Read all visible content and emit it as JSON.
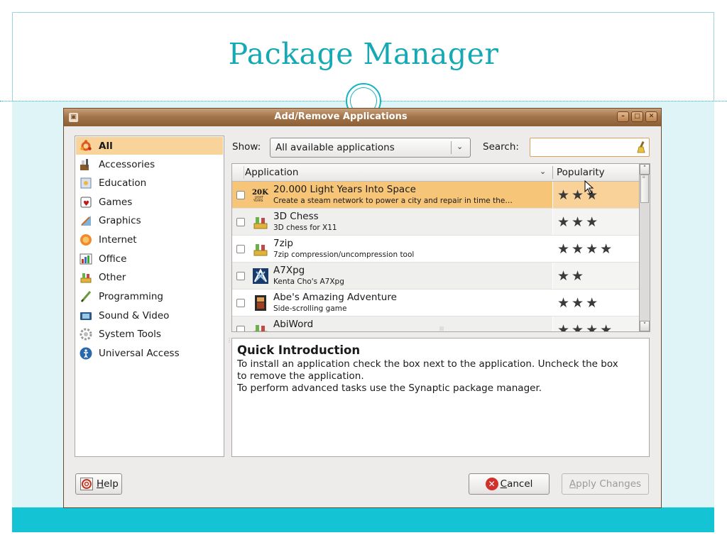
{
  "slide": {
    "title": "Package Manager",
    "colors": {
      "accent": "#14b3c0",
      "title": "#14a9b4",
      "footer": "#14c3d4",
      "body_bg": "#dff4f6"
    }
  },
  "window": {
    "title": "Add/Remove Applications",
    "icon": "package-icon",
    "controls": [
      "minimize-icon",
      "maximize-icon",
      "close-icon"
    ]
  },
  "categories": [
    {
      "label": "All",
      "icon": "ubuntu-logo-icon",
      "selected": true
    },
    {
      "label": "Accessories",
      "icon": "accessories-icon"
    },
    {
      "label": "Education",
      "icon": "education-icon"
    },
    {
      "label": "Games",
      "icon": "games-icon"
    },
    {
      "label": "Graphics",
      "icon": "graphics-icon"
    },
    {
      "label": "Internet",
      "icon": "internet-icon"
    },
    {
      "label": "Office",
      "icon": "office-icon"
    },
    {
      "label": "Other",
      "icon": "other-icon"
    },
    {
      "label": "Programming",
      "icon": "programming-icon"
    },
    {
      "label": "Sound & Video",
      "icon": "sound-video-icon"
    },
    {
      "label": "System Tools",
      "icon": "system-tools-icon"
    },
    {
      "label": "Universal Access",
      "icon": "universal-access-icon"
    }
  ],
  "filter": {
    "show_label": "Show:",
    "show_value": "All available applications",
    "search_label": "Search:",
    "search_value": ""
  },
  "app_list": {
    "columns": {
      "application": "Application",
      "popularity": "Popularity"
    },
    "rows": [
      {
        "name": "20.000 Light Years Into Space",
        "description": "Create a steam network to power a city and repair in time the…",
        "icon_text": "20K",
        "rating": 3,
        "selected": true
      },
      {
        "name": "3D Chess",
        "description": "3D chess for X11",
        "icon_text": "",
        "rating": 3
      },
      {
        "name": "7zip",
        "description": "7zip compression/uncompression tool",
        "icon_text": "",
        "rating": 4
      },
      {
        "name": "A7Xpg",
        "description": "Kenta Cho's A7Xpg",
        "icon_text": "",
        "rating": 2
      },
      {
        "name": "Abe's Amazing Adventure",
        "description": "Side-scrolling game",
        "icon_text": "",
        "rating": 3
      },
      {
        "name": "AbiWord",
        "description": "",
        "icon_text": "",
        "rating": 4
      }
    ]
  },
  "description": {
    "title": "Quick Introduction",
    "lines": [
      "To install an application check the box next to the application. Uncheck the box",
      "to remove the application.",
      "To perform advanced tasks use the Synaptic package manager."
    ]
  },
  "buttons": {
    "help_mnemonic": "H",
    "help_rest": "elp",
    "cancel_mnemonic": "C",
    "cancel_rest": "ancel",
    "apply_mnemonic": "A",
    "apply_rest": "pply Changes"
  }
}
